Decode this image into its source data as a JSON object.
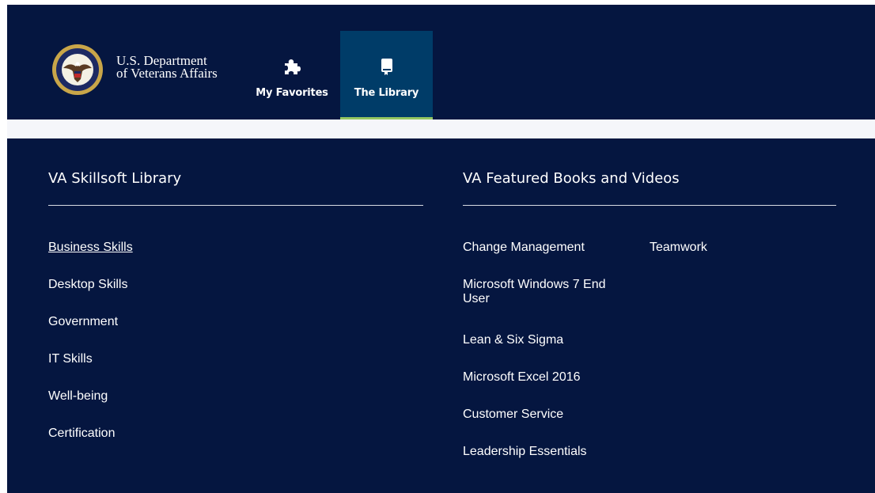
{
  "header": {
    "department_line1": "U.S. Department",
    "department_line2": "of Veterans Affairs",
    "seal_icon": "va-seal-icon",
    "tabs": [
      {
        "label": "My Favorites",
        "icon": "puzzle-icon",
        "active": false
      },
      {
        "label": "The Library",
        "icon": "book-icon",
        "active": true
      }
    ]
  },
  "library": {
    "title": "VA Skillsoft Library",
    "items": [
      {
        "label": "Business Skills",
        "underlined": true
      },
      {
        "label": "Desktop Skills"
      },
      {
        "label": "Government"
      },
      {
        "label": "IT Skills"
      },
      {
        "label": "Well-being"
      },
      {
        "label": "Certification"
      }
    ]
  },
  "featured": {
    "title": "VA Featured Books and Videos",
    "column1": [
      {
        "label": "Change Management"
      },
      {
        "label": "Microsoft Windows 7 End User"
      },
      {
        "label": "Lean & Six Sigma"
      },
      {
        "label": "Microsoft Excel 2016"
      },
      {
        "label": "Customer Service"
      },
      {
        "label": "Leadership Essentials"
      }
    ],
    "column2": [
      {
        "label": "Teamwork"
      }
    ]
  },
  "colors": {
    "navy": "#051640",
    "active_tab": "#003c68",
    "active_underline": "#93c761",
    "strip": "#f5f6fa",
    "seal_gold": "#c9a649"
  }
}
